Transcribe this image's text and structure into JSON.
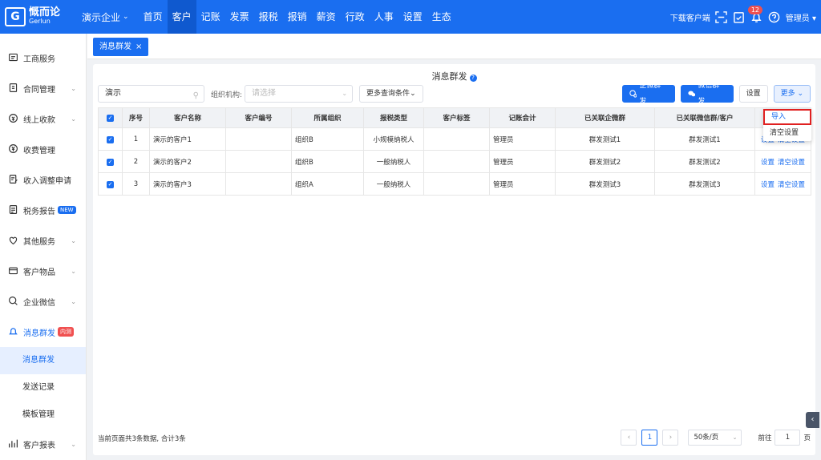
{
  "header": {
    "logo_mark": "G",
    "logo_name": "慨而论",
    "logo_sub": "Gerlun",
    "company": "演示企业",
    "nav": [
      "首页",
      "客户",
      "记账",
      "发票",
      "报税",
      "报销",
      "薪资",
      "行政",
      "人事",
      "设置",
      "生态"
    ],
    "active_nav": "客户",
    "download": "下载客户端",
    "badge": "12",
    "user": "管理员"
  },
  "sidebar": {
    "items": [
      {
        "label": "工商服务",
        "icon": "id-card-icon",
        "arrow": false
      },
      {
        "label": "合同管理",
        "icon": "contract-icon",
        "arrow": true
      },
      {
        "label": "线上收款",
        "icon": "payment-icon",
        "arrow": true
      },
      {
        "label": "收费管理",
        "icon": "yen-icon",
        "arrow": false
      },
      {
        "label": "收入调整申请",
        "icon": "document-edit-icon",
        "arrow": false
      },
      {
        "label": "税务报告",
        "icon": "report-icon",
        "arrow": false,
        "tag": "NEW"
      },
      {
        "label": "其他服务",
        "icon": "heart-icon",
        "arrow": true
      },
      {
        "label": "客户物品",
        "icon": "box-icon",
        "arrow": true
      },
      {
        "label": "企业微信",
        "icon": "chat-icon",
        "arrow": true
      }
    ],
    "open_group": {
      "label": "消息群发",
      "tag": "内测"
    },
    "sub_items": [
      "消息群发",
      "发送记录",
      "模板管理"
    ],
    "active_sub": "消息群发",
    "bottom_item": "客户报表"
  },
  "tabs": [
    {
      "label": "消息群发",
      "close": "×"
    }
  ],
  "page": {
    "title": "消息群发",
    "search_value": "演示",
    "org_label": "组织机构:",
    "org_placeholder": "请选择",
    "more_query": "更多查询条件",
    "btn_qiwei": "企微群发",
    "btn_weixin": "微信群发",
    "btn_settings": "设置",
    "btn_more": "更多"
  },
  "table": {
    "headers": [
      "序号",
      "客户名称",
      "客户编号",
      "所属组织",
      "报税类型",
      "客户标签",
      "记账会计",
      "已关联企微群",
      "已关联微信群/客户",
      ""
    ],
    "rows": [
      {
        "no": "1",
        "name": "演示的客户1",
        "code": "",
        "org": "组织B",
        "tax": "小规模纳税人",
        "tag": "",
        "acct": "管理员",
        "qw": "群发测试1",
        "wx": "群发测试1"
      },
      {
        "no": "2",
        "name": "演示的客户2",
        "code": "",
        "org": "组织B",
        "tax": "一般纳税人",
        "tag": "",
        "acct": "管理员",
        "qw": "群发测试2",
        "wx": "群发测试2"
      },
      {
        "no": "3",
        "name": "演示的客户3",
        "code": "",
        "org": "组织A",
        "tax": "一般纳税人",
        "tag": "",
        "acct": "管理员",
        "qw": "群发测试3",
        "wx": "群发测试3"
      }
    ],
    "op_set": "设置",
    "op_clear": "清空设置"
  },
  "dropdown": [
    "导入",
    "清空设置"
  ],
  "footer": {
    "summary": "当前页面共3条数据,  合计3条",
    "page": "1",
    "page_size": "50条/页",
    "goto_label": "前往",
    "goto_value": "1",
    "page_unit": "页"
  }
}
